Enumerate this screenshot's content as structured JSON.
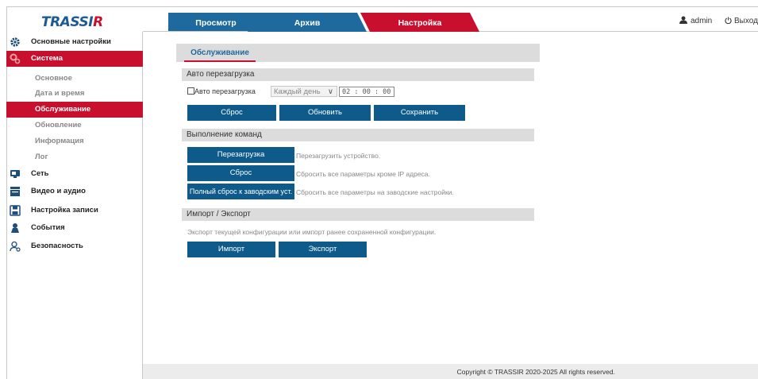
{
  "app": {
    "logo_main": "TRASSI",
    "logo_accent": "R"
  },
  "tabs": {
    "view": "Просмотр",
    "archive": "Архив",
    "settings": "Настройка"
  },
  "user": {
    "name": "admin",
    "logout": "Выход"
  },
  "sidebar": {
    "basic_settings": "Основные настройки",
    "system": "Система",
    "system_items": [
      "Основное",
      "Дата и время",
      "Обслуживание",
      "Обновление",
      "Информация",
      "Лог"
    ],
    "network": "Сеть",
    "video_audio": "Видео и аудио",
    "record_settings": "Настройка записи",
    "events": "События",
    "security": "Безопасность"
  },
  "main": {
    "tab_title": "Обслуживание",
    "auto_reboot": {
      "title": "Авто перезагрузка",
      "checkbox_label": "Авто перезагрузка",
      "schedule_value": "Каждый день",
      "time_value": "02 : 00 : 00",
      "reset_btn": "Сброс",
      "refresh_btn": "Обновить",
      "save_btn": "Сохранить"
    },
    "commands": {
      "title": "Выполнение команд",
      "reboot_btn": "Перезагрузка",
      "reboot_desc": "Перезагрузить устройство.",
      "reset_btn": "Сброс",
      "reset_desc": "Сбросить все параметры кроме IP адреса.",
      "factory_btn": "Полный сброс к заводским уст.",
      "factory_desc": "Сбросить все параметры на заводские настройки."
    },
    "import_export": {
      "title": "Импорт / Экспорт",
      "desc": "Экспорт текущей конфигурации или импорт ранее сохраненной конфигурации.",
      "import_btn": "Импорт",
      "export_btn": "Экспорт"
    }
  },
  "footer": {
    "copyright": "Copyright © TRASSIR 2020-2025 All rights reserved."
  },
  "colors": {
    "brand_blue": "#1e6a9e",
    "brand_red": "#c8102e",
    "button_blue": "#0e5a8a"
  }
}
